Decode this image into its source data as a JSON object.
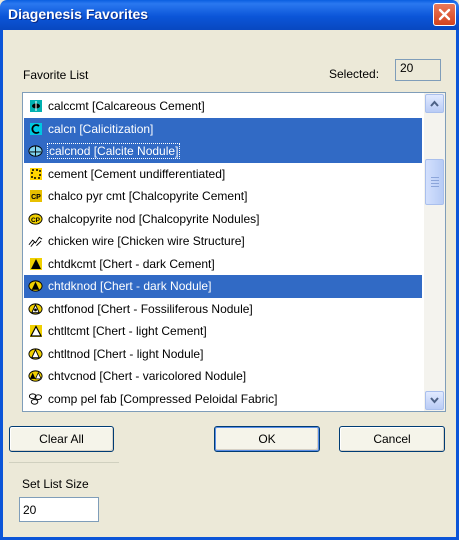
{
  "window": {
    "title": "Diagenesis Favorites"
  },
  "favorite_list": {
    "label": "Favorite List",
    "selected_label": "Selected:",
    "selected_count": "20",
    "items": [
      {
        "label": "calccmt [Calcareous Cement]",
        "icon": "calcite-cement-icon",
        "selected": false
      },
      {
        "label": "calcn [Calicitization]",
        "icon": "calicitization-icon",
        "selected": true
      },
      {
        "label": "calcnod [Calcite Nodule]",
        "icon": "calcite-nodule-icon",
        "selected": true
      },
      {
        "label": "cement [Cement undifferentiated]",
        "icon": "cement-icon",
        "selected": false
      },
      {
        "label": "chalco pyr cmt [Chalcopyrite Cement]",
        "icon": "chalcopyrite-cement-icon",
        "selected": false
      },
      {
        "label": "chalcopyrite nod [Chalcopyrite Nodules]",
        "icon": "chalcopyrite-nodule-icon",
        "selected": false
      },
      {
        "label": "chicken wire [Chicken wire Structure]",
        "icon": "chicken-wire-icon",
        "selected": false
      },
      {
        "label": "chtdkcmt [Chert - dark Cement]",
        "icon": "chert-dark-cement-icon",
        "selected": false
      },
      {
        "label": "chtdknod [Chert - dark Nodule]",
        "icon": "chert-dark-nodule-icon",
        "selected": true
      },
      {
        "label": "chtfonod [Chert - Fossiliferous Nodule]",
        "icon": "chert-fossiliferous-nodule-icon",
        "selected": false
      },
      {
        "label": "chtltcmt [Chert - light Cement]",
        "icon": "chert-light-cement-icon",
        "selected": false
      },
      {
        "label": "chtltnod [Chert - light Nodule]",
        "icon": "chert-light-nodule-icon",
        "selected": false
      },
      {
        "label": "chtvcnod [Chert - varicolored Nodule]",
        "icon": "chert-varicolored-nodule-icon",
        "selected": false
      },
      {
        "label": "comp pel fab [Compressed Peloidal Fabric]",
        "icon": "peloidal-fabric-icon",
        "selected": false
      }
    ]
  },
  "buttons": {
    "clear_all": "Clear All",
    "ok": "OK",
    "cancel": "Cancel"
  },
  "list_size": {
    "label": "Set List Size",
    "value": "20"
  },
  "colors": {
    "selection": "#316ac5",
    "title_bar": "#0b55d8",
    "close_button": "#d4431e"
  }
}
